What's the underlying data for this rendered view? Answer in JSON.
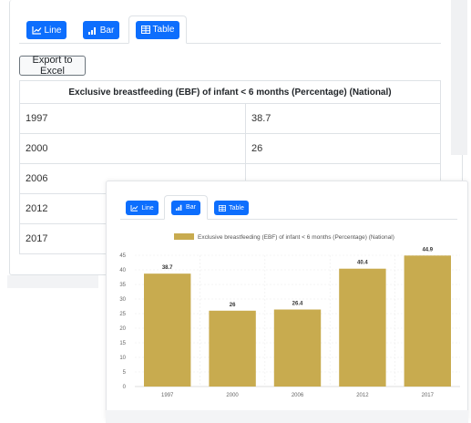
{
  "tabs": {
    "line_label": "Line",
    "bar_label": "Bar",
    "table_label": "Table"
  },
  "export_label": "Export to Excel",
  "table": {
    "header": "Exclusive breastfeeding (EBF) of infant < 6 months (Percentage) (National)",
    "rows": [
      {
        "year": "1997",
        "value": "38.7"
      },
      {
        "year": "2000",
        "value": "26"
      },
      {
        "year": "2006",
        "value": ""
      },
      {
        "year": "2012",
        "value": ""
      },
      {
        "year": "2017",
        "value": ""
      }
    ]
  },
  "colors": {
    "primary": "#0d6efd",
    "bar": "#c8ab4f",
    "border": "#dee2e6"
  },
  "chart_data": {
    "type": "bar",
    "title": "",
    "xlabel": "",
    "ylabel": "",
    "legend": "top",
    "grid": true,
    "categories": [
      "1997",
      "2000",
      "2006",
      "2012",
      "2017"
    ],
    "series": [
      {
        "name": "Exclusive breastfeeding (EBF) of infant < 6 months (Percentage) (National)",
        "values": [
          38.7,
          26,
          26.4,
          40.4,
          44.9
        ],
        "labels": [
          "38.7",
          "26",
          "26.4",
          "40.4",
          "44.9"
        ]
      }
    ],
    "ylim": [
      0,
      45
    ],
    "yticks": [
      0,
      5,
      10,
      15,
      20,
      25,
      30,
      35,
      40,
      45
    ]
  }
}
